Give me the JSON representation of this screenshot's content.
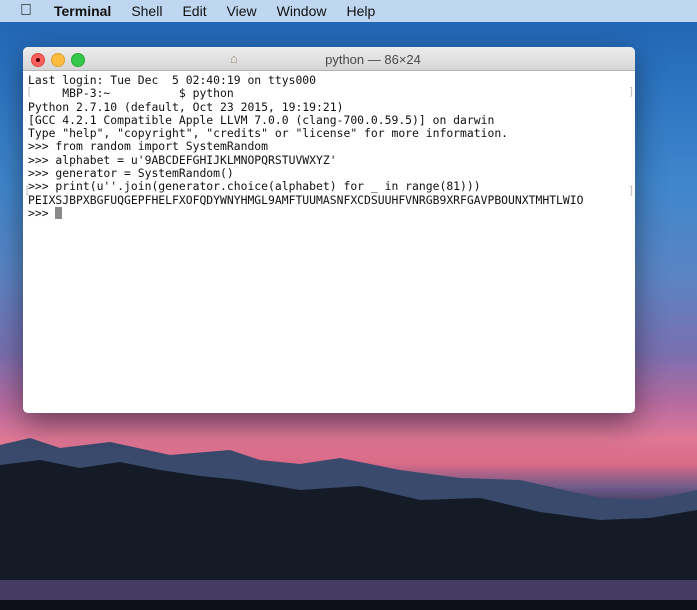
{
  "menubar": {
    "apple_icon": "apple-icon",
    "app_name": "Terminal",
    "items": [
      "Shell",
      "Edit",
      "View",
      "Window",
      "Help"
    ]
  },
  "window": {
    "title": "python — 86×24",
    "title_icon": "home-icon",
    "lines": [
      "Last login: Tue Dec  5 02:40:19 on ttys000",
      "     MBP-3:~          $ python",
      "Python 2.7.10 (default, Oct 23 2015, 19:19:21)",
      "[GCC 4.2.1 Compatible Apple LLVM 7.0.0 (clang-700.0.59.5)] on darwin",
      "Type \"help\", \"copyright\", \"credits\" or \"license\" for more information.",
      ">>> from random import SystemRandom",
      ">>> alphabet = u'9ABCDEFGHIJKLMNOPQRSTUVWXYZ'",
      ">>> generator = SystemRandom()",
      ">>> print(u''.join(generator.choice(alphabet) for _ in range(81)))",
      "PEIXSJBPXBGFUQGEPFHELFXOFQDYWNYHMGL9AMFTUUMASNFXCDSUUHFVNRGB9XRFGAVPBOUNXTMHTLWIO",
      ">>> "
    ]
  }
}
